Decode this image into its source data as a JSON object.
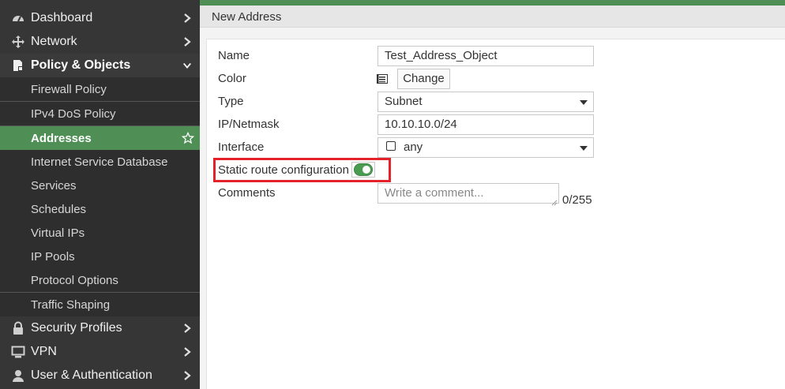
{
  "sidebar": {
    "items": [
      {
        "label": "Dashboard",
        "icon": "dashboard-icon"
      },
      {
        "label": "Network",
        "icon": "network-move-icon"
      },
      {
        "label": "Policy & Objects",
        "icon": "policy-icon"
      },
      {
        "label": "Firewall Policy"
      },
      {
        "label": "IPv4 DoS Policy"
      },
      {
        "label": "Addresses"
      },
      {
        "label": "Internet Service Database"
      },
      {
        "label": "Services"
      },
      {
        "label": "Schedules"
      },
      {
        "label": "Virtual IPs"
      },
      {
        "label": "IP Pools"
      },
      {
        "label": "Protocol Options"
      },
      {
        "label": "Traffic Shaping"
      },
      {
        "label": "Security Profiles",
        "icon": "lock-icon"
      },
      {
        "label": "VPN",
        "icon": "monitor-icon"
      },
      {
        "label": "User & Authentication",
        "icon": "user-icon"
      }
    ]
  },
  "page": {
    "title": "New Address"
  },
  "form": {
    "name_label": "Name",
    "name_value": "Test_Address_Object",
    "color_label": "Color",
    "change_button": "Change",
    "type_label": "Type",
    "type_value": "Subnet",
    "ipmask_label": "IP/Netmask",
    "ipmask_value": "10.10.10.0/24",
    "interface_label": "Interface",
    "interface_value": "any",
    "static_route_label": "Static route configuration",
    "static_route_enabled": true,
    "comments_label": "Comments",
    "comments_placeholder": "Write a comment...",
    "comments_counter": "0/255"
  },
  "colors": {
    "accent": "#4f8f55",
    "sidebar_bg": "#363636",
    "highlight_box": "#e3222c"
  }
}
